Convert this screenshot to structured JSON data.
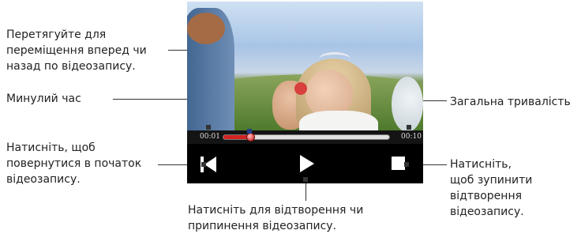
{
  "callouts": {
    "seek": "Перетягуйте для\nпереміщення вперед чи\nназад по відеозапису.",
    "elapsed": "Минулий час",
    "total": "Загальна тривалість",
    "restart": "Натисніть, щоб\nповернутися в початок\nвідеозапису.",
    "stop": "Натисніть,\nщоб зупинити\nвідтворення\nвідеозапису.",
    "play": "Натисніть для відтворення чи\nприпинення відеозапису."
  },
  "player": {
    "elapsed_time": "00:01",
    "total_time": "00:10",
    "progress": 0.16,
    "accent_color": "#d32222"
  },
  "icons": {
    "previous": "skip-to-start-icon",
    "play": "play-icon",
    "stop": "stop-icon"
  }
}
